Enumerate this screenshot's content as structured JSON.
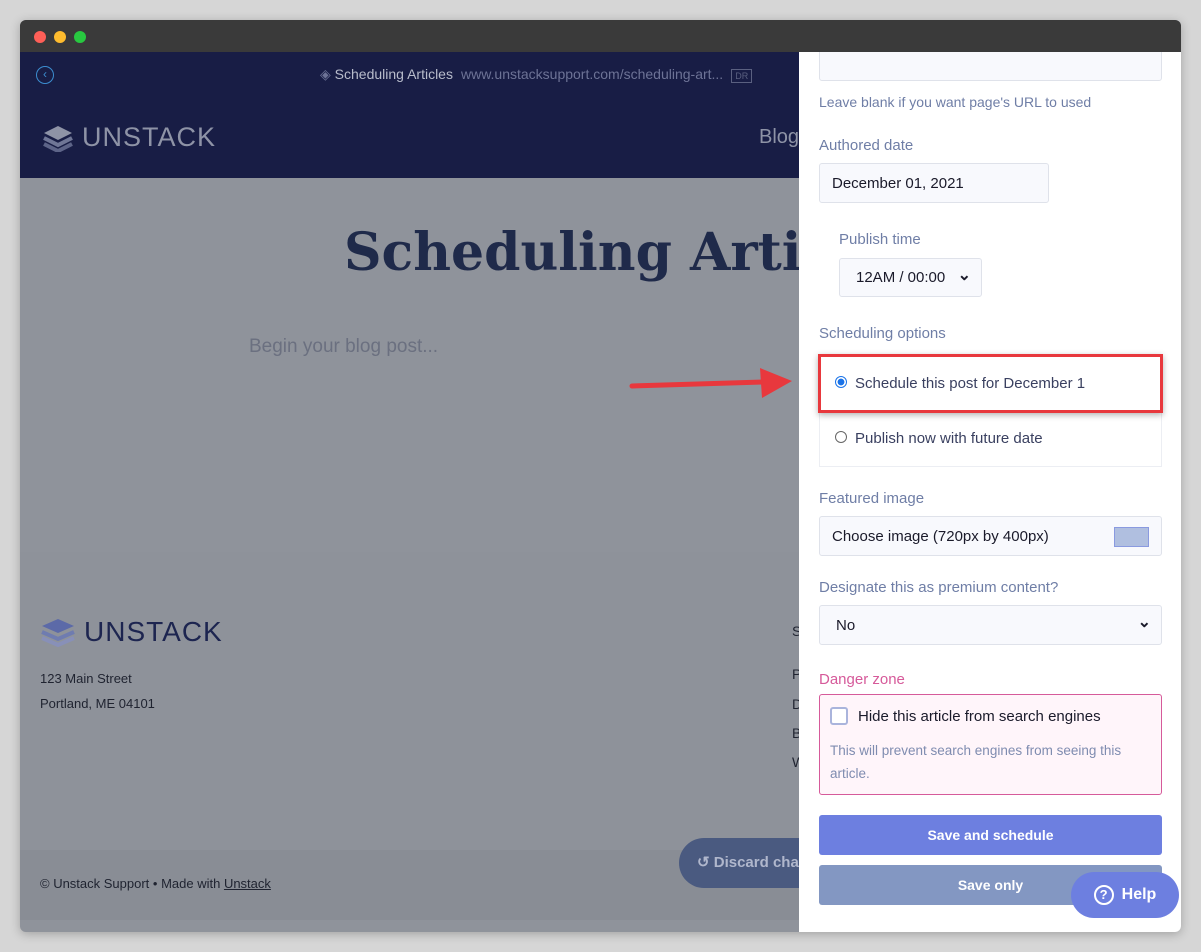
{
  "window": {
    "controls": [
      "close",
      "minimize",
      "maximize"
    ]
  },
  "site": {
    "back_icon": "chevron-left-circle-icon",
    "page_name": "Scheduling Articles",
    "page_url": "www.unstacksupport.com/scheduling-art...",
    "status_badge": "DR",
    "brand": "UNSTACK",
    "nav_blog": "Blog",
    "article_title": "Scheduling Artic",
    "body_placeholder": "Begin your blog post...",
    "footer": {
      "brand": "UNSTACK",
      "address1": "123 Main Street",
      "address2": "Portland, ME 04101",
      "col_letters": [
        "S",
        "P",
        "D",
        "B",
        "W"
      ],
      "copyright": "© Unstack Support • Made with ",
      "copyright_link": "Unstack"
    },
    "discard_label": "Discard cha"
  },
  "panel": {
    "url_hint": "Leave blank if you want page's URL to used",
    "authored_label": "Authored date",
    "authored_value": "December 01, 2021",
    "publish_time_label": "Publish time",
    "publish_time_value": "12AM / 00:00",
    "scheduling_label": "Scheduling options",
    "option_schedule": "Schedule this post for December 1",
    "option_publish_now": "Publish now with future date",
    "featured_label": "Featured image",
    "featured_value": "Choose image (720px by 400px)",
    "premium_label": "Designate this as premium content?",
    "premium_value": "No",
    "danger_label": "Danger zone",
    "hide_label": "Hide this article from search engines",
    "hide_help": "This will prevent search engines from seeing this article.",
    "save_schedule": "Save and schedule",
    "save_only": "Save only"
  },
  "help_label": "Help",
  "colors": {
    "accent": "#6d7fe0",
    "danger": "#d65a9a",
    "highlight": "#e8383d",
    "navy": "#181d45"
  }
}
